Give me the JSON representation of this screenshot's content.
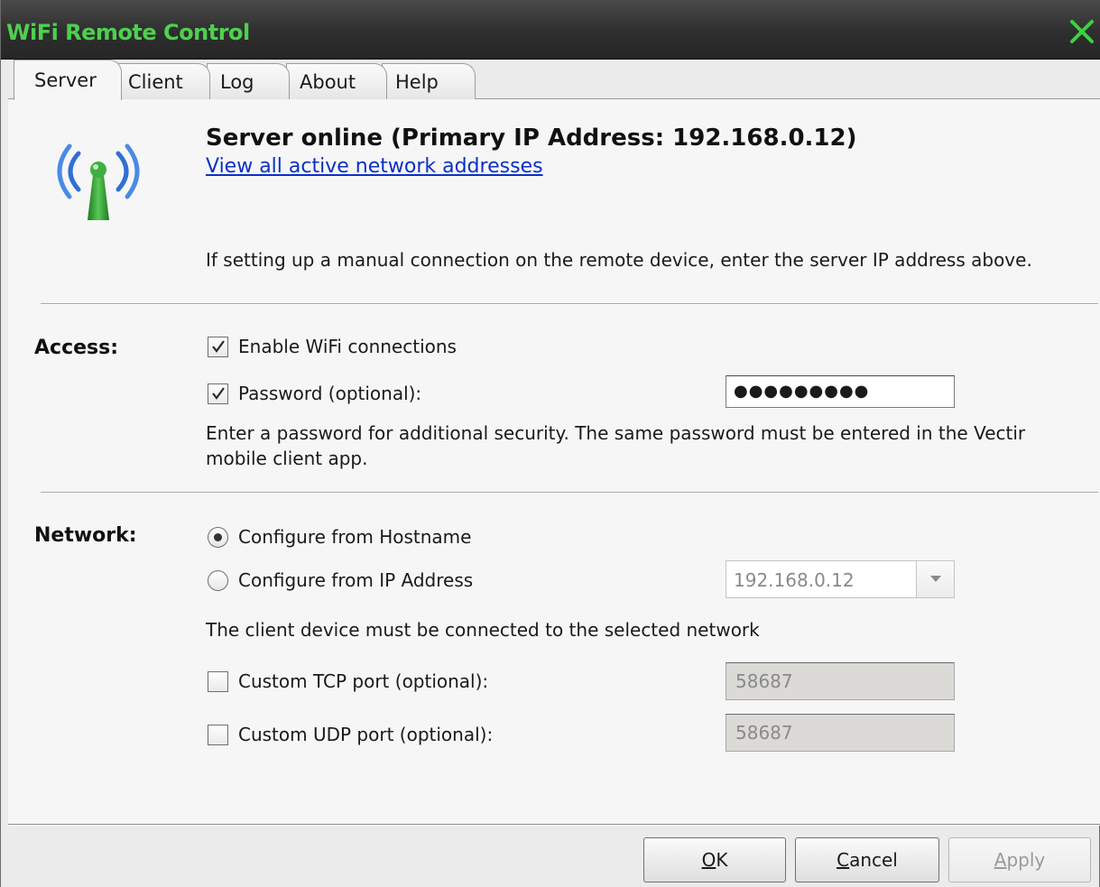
{
  "window": {
    "title": "WiFi Remote Control",
    "title_color": "#4ed04e"
  },
  "tabs": [
    {
      "label": "Server",
      "active": true
    },
    {
      "label": "Client",
      "active": false
    },
    {
      "label": "Log",
      "active": false
    },
    {
      "label": "About",
      "active": false
    },
    {
      "label": "Help",
      "active": false
    }
  ],
  "status": {
    "icon": "wifi-antenna-icon",
    "title": "Server online (Primary IP Address: 192.168.0.12)",
    "link": "View all active network addresses",
    "hint": "If setting up a manual connection on the remote device, enter the server IP address above."
  },
  "access": {
    "label": "Access:",
    "enable_wifi": {
      "label": "Enable WiFi connections",
      "checked": true
    },
    "password": {
      "label": "Password (optional):",
      "checked": true,
      "value": "●●●●●●●●●"
    },
    "note_line1": "Enter a password for additional security. The same password must be entered in the Vectir",
    "note_line2": "mobile client app."
  },
  "network": {
    "label": "Network:",
    "from_hostname": {
      "label": "Configure from Hostname",
      "selected": true
    },
    "from_ip": {
      "label": "Configure from IP Address",
      "selected": false,
      "value": "192.168.0.12"
    },
    "note": "The client device must be connected to the selected network",
    "tcp_port": {
      "label": "Custom TCP port (optional):",
      "checked": false,
      "value": "58687"
    },
    "udp_port": {
      "label": "Custom UDP port (optional):",
      "checked": false,
      "value": "58687"
    }
  },
  "buttons": {
    "ok_mnemonic": "O",
    "ok_rest": "K",
    "cancel_mnemonic": "C",
    "cancel_rest": "ancel",
    "apply_mnemonic": "A",
    "apply_rest": "pply"
  },
  "colors": {
    "link": "#0a30c8",
    "antenna_green": "#3aa53a",
    "wave_blue": "#3a7fe0"
  }
}
